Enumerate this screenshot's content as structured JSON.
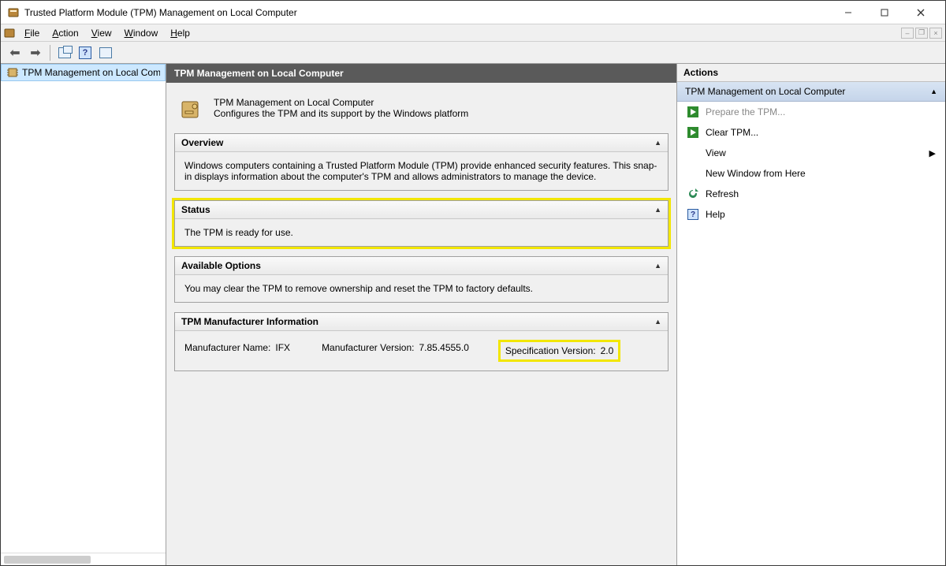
{
  "window": {
    "title": "Trusted Platform Module (TPM) Management on Local Computer"
  },
  "menu": {
    "file": "File",
    "action": "Action",
    "view": "View",
    "window": "Window",
    "help": "Help"
  },
  "nav": {
    "rootLabel": "TPM Management on Local Comp"
  },
  "content": {
    "headerTitle": "TPM Management on Local Computer",
    "descTitle": "TPM Management on Local Computer",
    "descBody": "Configures the TPM and its support by the Windows platform",
    "panels": {
      "overview": {
        "title": "Overview",
        "body": "Windows computers containing a Trusted Platform Module (TPM) provide enhanced security features. This snap-in displays information about the computer's TPM and allows administrators to manage the device."
      },
      "status": {
        "title": "Status",
        "body": "The TPM is ready for use."
      },
      "options": {
        "title": "Available Options",
        "body": "You may clear the TPM to remove ownership and reset the TPM to factory defaults."
      },
      "mfr": {
        "title": "TPM Manufacturer Information",
        "nameLabel": "Manufacturer Name:",
        "nameValue": "IFX",
        "versionLabel": "Manufacturer Version:",
        "versionValue": "7.85.4555.0",
        "specLabel": "Specification Version:",
        "specValue": "2.0"
      }
    }
  },
  "actions": {
    "header": "Actions",
    "groupTitle": "TPM Management on Local Computer",
    "items": {
      "prepare": "Prepare the TPM...",
      "clear": "Clear TPM...",
      "view": "View",
      "newWindow": "New Window from Here",
      "refresh": "Refresh",
      "help": "Help"
    }
  }
}
